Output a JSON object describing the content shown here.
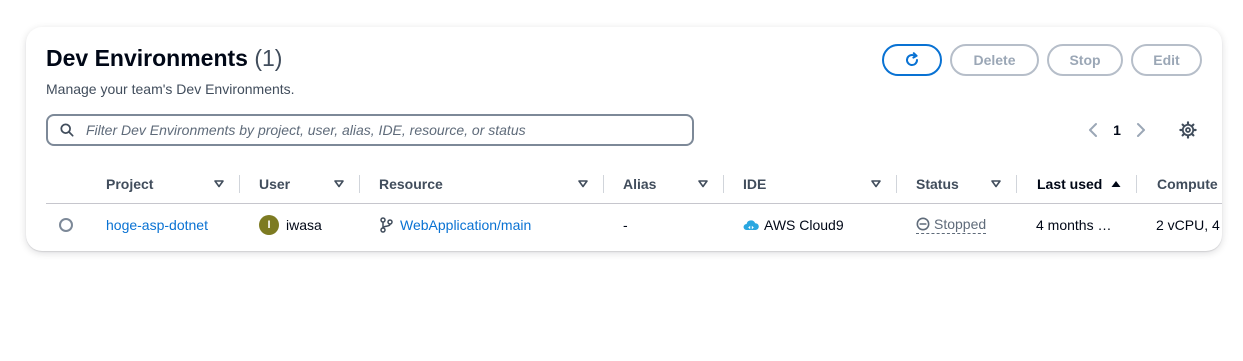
{
  "header": {
    "title": "Dev Environments",
    "count": "(1)",
    "description": "Manage your team's Dev Environments."
  },
  "actions": {
    "refresh_icon": "refresh-icon",
    "delete_label": "Delete",
    "stop_label": "Stop",
    "edit_label": "Edit"
  },
  "filter": {
    "placeholder": "Filter Dev Environments by project, user, alias, IDE, resource, or status",
    "value": ""
  },
  "pagination": {
    "current_page": "1"
  },
  "table": {
    "columns": [
      {
        "label": "Project"
      },
      {
        "label": "User"
      },
      {
        "label": "Resource"
      },
      {
        "label": "Alias"
      },
      {
        "label": "IDE"
      },
      {
        "label": "Status"
      },
      {
        "label": "Last used"
      },
      {
        "label": "Compute"
      }
    ],
    "sorted_column": "Last used",
    "sort_direction": "ascending",
    "rows": [
      {
        "project": "hoge-asp-dotnet",
        "user_initial": "I",
        "user": "iwasa",
        "resource": "WebApplication/main",
        "alias": "-",
        "ide": "AWS Cloud9",
        "status": "Stopped",
        "last_used": "4 months …",
        "compute": "2 vCPU, 4"
      }
    ]
  },
  "colors": {
    "link": "#0972d3",
    "avatar": "#7d7b22",
    "disabled": "#9ba7b6",
    "cloud9": "#2aa7e0"
  }
}
